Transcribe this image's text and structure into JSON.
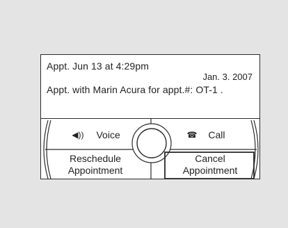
{
  "message": {
    "line1": "Appt. Jun  13 at  4:29pm",
    "date": "Jan. 3. 2007",
    "line2": "Appt. with Marin Acura for appt.#: OT-1 ."
  },
  "buttons": {
    "voice": {
      "label": "Voice",
      "icon": "speaker-icon",
      "glyph": "◀))"
    },
    "call": {
      "label": "Call",
      "icon": "phone-icon",
      "glyph": "☎"
    },
    "reschedule": {
      "line1": "Reschedule",
      "line2": "Appointment"
    },
    "cancel": {
      "line1": "Cancel",
      "line2": "Appointment",
      "selected": true
    }
  },
  "colors": {
    "frame": "#2a2a2a",
    "background": "#e4e4e4",
    "screen": "#ffffff"
  }
}
